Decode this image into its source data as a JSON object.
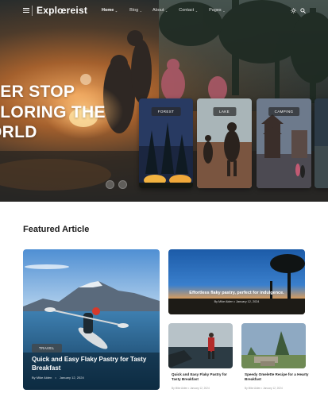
{
  "nav": {
    "logo": "Explœreist",
    "links": [
      {
        "label": "Home",
        "active": true
      },
      {
        "label": "Blog"
      },
      {
        "label": "About"
      },
      {
        "label": "Contact"
      },
      {
        "label": "Pages"
      }
    ],
    "icons": [
      "menu-icon",
      "sun-icon",
      "search-icon"
    ]
  },
  "hero": {
    "title_lines": [
      "VER STOP",
      "PLORING THE",
      "ORLD"
    ],
    "cards": [
      {
        "tag": "FOREST"
      },
      {
        "tag": "LAKE"
      },
      {
        "tag": "CAMPING"
      }
    ]
  },
  "featured": {
    "heading": "Featured Article",
    "main": {
      "tag": "TRAVEL",
      "title": "Quick and Easy Flaky Pastry for Tasty Breakfast",
      "author": "By Mike Aiden",
      "date": "January 12, 2024"
    },
    "wide": {
      "title": "Effortless flaky pastry, perfect for indulgence.",
      "author": "By Mike Aiden",
      "date": "January 12, 2024"
    },
    "small": [
      {
        "title": "Quick and Easy Flaky Pastry for Tasty Breakfast",
        "author": "By Mike Aiden",
        "date": "January 12, 2024"
      },
      {
        "title": "Speedy Omelette Recipe for a Hearty Breakfast",
        "author": "By Mike Aiden",
        "date": "January 12, 2024"
      }
    ]
  },
  "colors": {
    "heading": "#1b1b1b",
    "text_light": "#ffffff"
  }
}
